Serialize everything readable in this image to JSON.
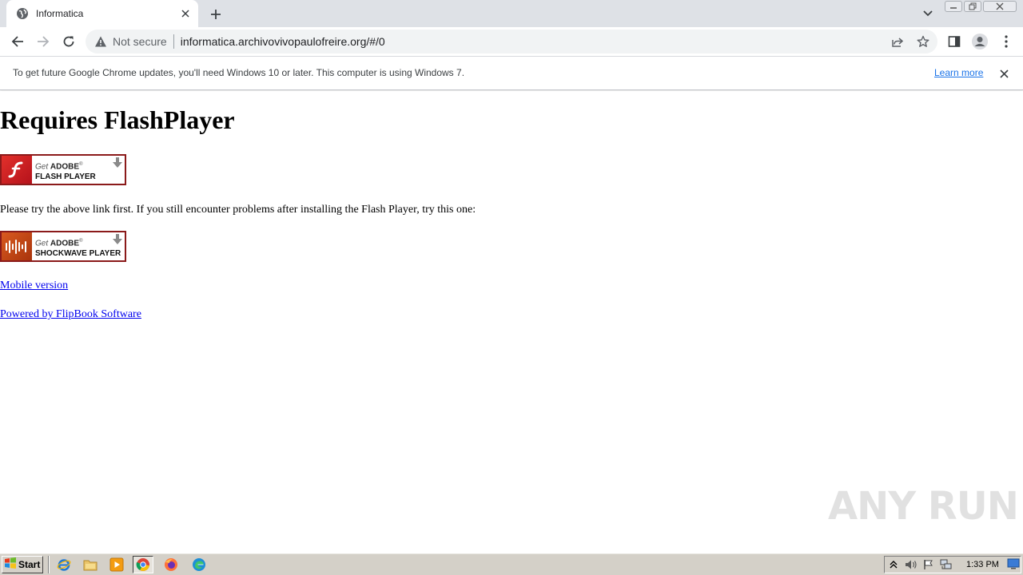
{
  "browser": {
    "tab": {
      "title": "Informatica"
    },
    "omnibox": {
      "security_label": "Not secure",
      "url": "informatica.archivovivopaulofreire.org/#/0"
    },
    "infobar": {
      "message": "To get future Google Chrome updates, you'll need Windows 10 or later. This computer is using Windows 7.",
      "link_label": "Learn more"
    }
  },
  "page": {
    "title": "Requires FlashPlayer",
    "flash_badge": {
      "get": "Get",
      "brand": "ADOBE",
      "product": "FLASH PLAYER",
      "mark": "®"
    },
    "instructions": "Please try the above link first. If you still encounter problems after installing the Flash Player, try this one:",
    "shockwave_badge": {
      "get": "Get",
      "brand": "ADOBE",
      "product": "SHOCKWAVE PLAYER",
      "mark": "®"
    },
    "mobile_link": "Mobile version",
    "powered_link": "Powered by FlipBook Software"
  },
  "watermark": "ANY RUN",
  "taskbar": {
    "start_label": "Start",
    "clock": "1:33 PM",
    "pinned": [
      "internet-explorer-icon",
      "file-explorer-icon",
      "media-player-icon",
      "chrome-icon",
      "firefox-icon",
      "edge-icon"
    ]
  },
  "colors": {
    "tabstrip": "#dee1e6",
    "link": "#0000ee",
    "infobar_link": "#1a73e8",
    "flash_red": "#e2302b",
    "shockwave_orange": "#d95a1f",
    "taskbar": "#d4d0c8"
  }
}
